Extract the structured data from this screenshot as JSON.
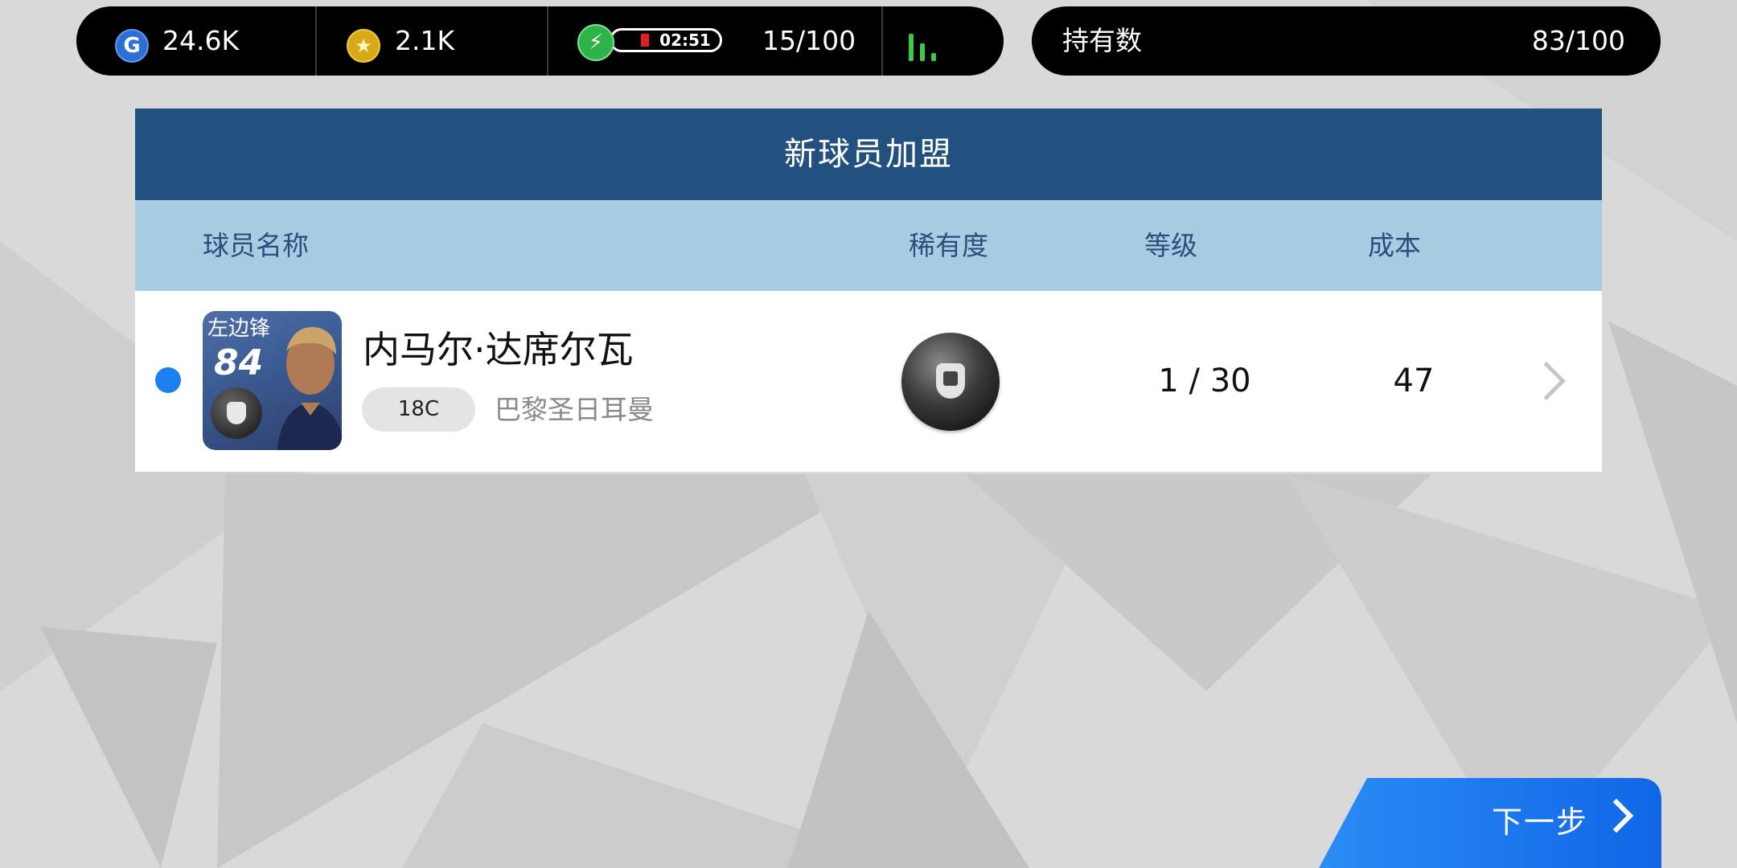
{
  "hud": {
    "gp_icon": "g-coin-icon",
    "gp_value": "24.6K",
    "coins_icon": "star-coin-icon",
    "coins_value": "2.1K",
    "energy_icon": "lightning-icon",
    "energy_timer": "02:51",
    "energy_count": "15/100",
    "signal_icon": "signal-bars-icon",
    "colors": {
      "gp": "#2c6fd6",
      "coin": "#d7a817",
      "energy": "#2eb34a",
      "signal": "#3fc74a",
      "timer_bar": "#e32020"
    }
  },
  "owned": {
    "label": "持有数",
    "value": "83/100"
  },
  "panel": {
    "title": "新球员加盟",
    "columns": {
      "name": "球员名称",
      "rarity": "稀有度",
      "level": "等级",
      "cost": "成本"
    },
    "header_color": "#23517f",
    "column_header_color": "#a8cde2"
  },
  "players": [
    {
      "position": "左边锋",
      "rating": "84",
      "name": "内马尔·达席尔瓦",
      "tag": "18C",
      "club": "巴黎圣日耳曼",
      "rarity_icon": "black-ball-icon",
      "level": "1 / 30",
      "cost": "47",
      "selected": true
    }
  ],
  "next_button": {
    "label": "下一步",
    "icon": "chevron-right-icon",
    "color": "#1d7ff0"
  }
}
